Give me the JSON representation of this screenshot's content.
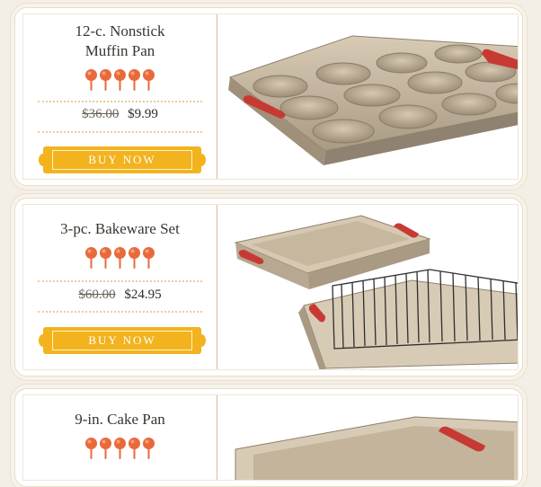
{
  "products": [
    {
      "title_line1": "12-c. Nonstick",
      "title_line2": "Muffin Pan",
      "rating": 5,
      "old_price": "$36.00",
      "price": "$9.99",
      "button": "BUY NOW",
      "image": "muffin-pan"
    },
    {
      "title_line1": "3-pc. Bakeware Set",
      "title_line2": "",
      "rating": 5,
      "old_price": "$60.00",
      "price": "$24.95",
      "button": "BUY NOW",
      "image": "bakeware-set"
    },
    {
      "title_line1": "9-in. Cake Pan",
      "title_line2": "",
      "rating": 5,
      "image": "cake-pan"
    }
  ],
  "colors": {
    "accent": "#f2b31e",
    "rating": "#e86a3b",
    "divider": "#e7b78a",
    "pan": "#cbbba3",
    "handle": "#c73a33"
  }
}
